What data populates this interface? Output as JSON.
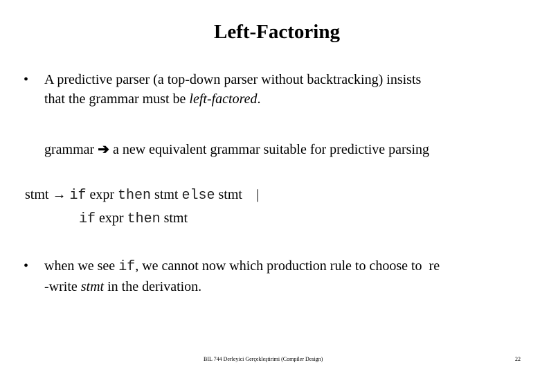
{
  "slide": {
    "title": "Left-Factoring",
    "bullet1": {
      "marker": "•",
      "line1": "A predictive parser (a top-down parser without backtracking) insists",
      "line2_prefix": "that the grammar must be ",
      "line2_italic": "left-factored",
      "line2_suffix": "."
    },
    "transform": {
      "from": "grammar",
      "arrow": "➔",
      "to": "a new equivalent grammar suitable for predictive parsing"
    },
    "production": {
      "lhs": "stmt",
      "arrow": "→",
      "alt1": {
        "kw_if": "if",
        "expr": " expr ",
        "kw_then": "then",
        "stmt1": " stmt ",
        "kw_else": "else",
        "stmt2": " stmt ",
        "bar": "|"
      },
      "alt2": {
        "kw_if": "if",
        "expr": " expr ",
        "kw_then": "then",
        "stmt": " stmt"
      }
    },
    "bullet2": {
      "marker": "•",
      "line1_prefix": "when we see ",
      "line1_code": "if",
      "line1_suffix": ", we cannot now which production rule to choose to  re",
      "line2_prefix": "-write ",
      "line2_italic": "stmt",
      "line2_suffix": " in the derivation."
    },
    "footer": "BIL 744 Derleyici Gerçekleştirimi (Compiler Design)",
    "page_number": "22"
  }
}
